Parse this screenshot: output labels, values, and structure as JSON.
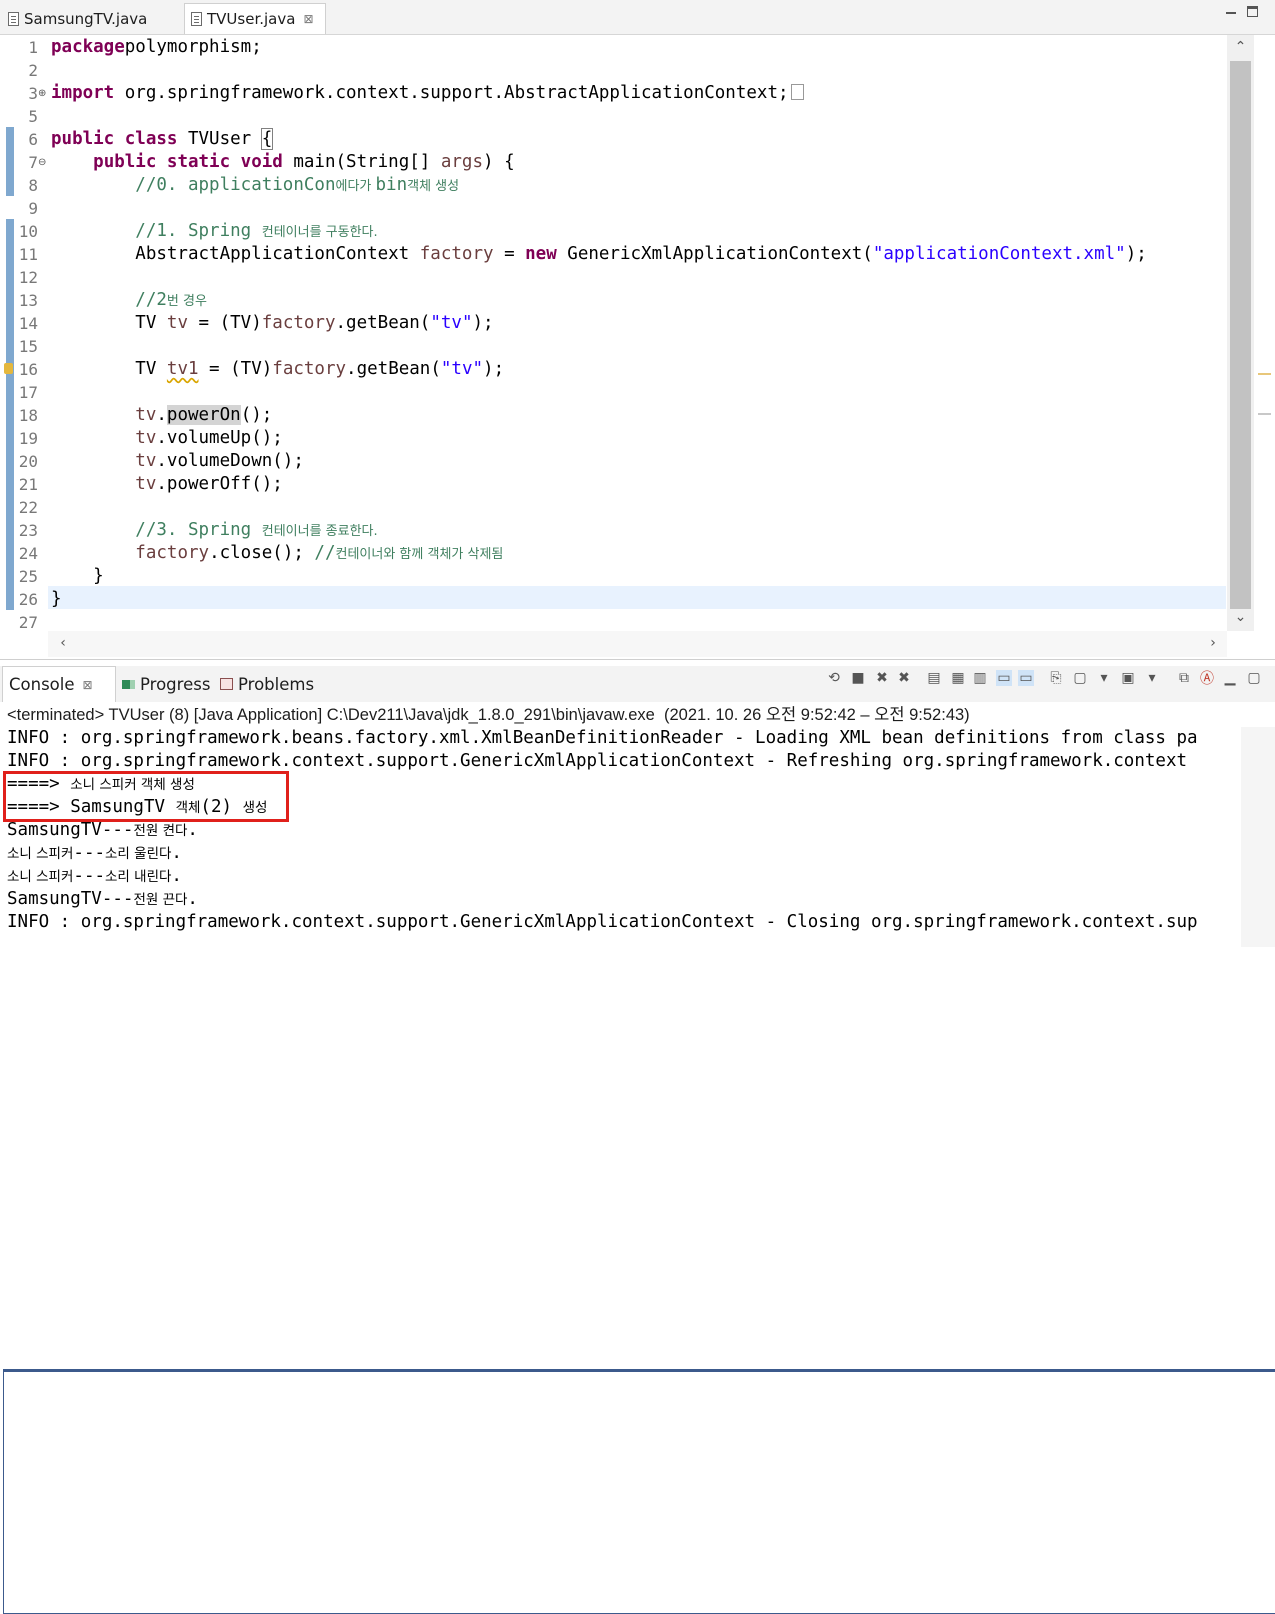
{
  "editor_tabs": [
    {
      "label": "SamsungTV.java",
      "active": false
    },
    {
      "label": "TVUser.java",
      "active": true,
      "close": "⊠"
    }
  ],
  "code_lines": [
    {
      "n": "1",
      "segs": [
        [
          "kw",
          "package"
        ],
        [
          "",
          "polymorphism;"
        ]
      ]
    },
    {
      "n": "2",
      "segs": []
    },
    {
      "n": "3",
      "segs": [
        [
          "kw",
          "import"
        ],
        [
          "",
          " org.springframework.context.support.AbstractApplicationContext;"
        ]
      ]
    },
    {
      "n": "5",
      "segs": []
    },
    {
      "n": "6",
      "segs": [
        [
          "kw",
          "public class"
        ],
        [
          "",
          " TVUser "
        ],
        [
          "brace",
          "{"
        ]
      ]
    },
    {
      "n": "7",
      "segs": [
        [
          "",
          "    "
        ],
        [
          "kw",
          "public static void"
        ],
        [
          "",
          " main(String[] "
        ],
        [
          "var",
          "args"
        ],
        [
          "",
          ") {"
        ]
      ]
    },
    {
      "n": "8",
      "segs": [
        [
          "",
          "        "
        ],
        [
          "cm",
          "//0. applicationCon"
        ],
        [
          "cmko",
          "에다가 "
        ],
        [
          "cm",
          "bin"
        ],
        [
          "cmko",
          "객체 생성"
        ]
      ]
    },
    {
      "n": "9",
      "segs": []
    },
    {
      "n": "10",
      "segs": [
        [
          "",
          "        "
        ],
        [
          "cm",
          "//1. Spring "
        ],
        [
          "cmko",
          "컨테이너를 구동한다."
        ]
      ]
    },
    {
      "n": "11",
      "segs": [
        [
          "",
          "        AbstractApplicationContext "
        ],
        [
          "var",
          "factory"
        ],
        [
          "",
          " = "
        ],
        [
          "kw",
          "new"
        ],
        [
          "",
          " GenericXmlApplicationContext("
        ],
        [
          "str",
          "\"applicationContext.xml\""
        ],
        [
          "",
          ");"
        ]
      ]
    },
    {
      "n": "12",
      "segs": []
    },
    {
      "n": "13",
      "segs": [
        [
          "",
          "        "
        ],
        [
          "cm",
          "//2"
        ],
        [
          "cmko",
          "번 경우"
        ]
      ]
    },
    {
      "n": "14",
      "segs": [
        [
          "",
          "        TV "
        ],
        [
          "var",
          "tv"
        ],
        [
          "",
          " = (TV)"
        ],
        [
          "var",
          "factory"
        ],
        [
          "",
          ".getBean("
        ],
        [
          "str",
          "\"tv\""
        ],
        [
          "",
          ");"
        ]
      ]
    },
    {
      "n": "15",
      "segs": []
    },
    {
      "n": "16",
      "segs": [
        [
          "",
          "        TV "
        ],
        [
          "varwarn",
          "tv1"
        ],
        [
          "",
          " = (TV)"
        ],
        [
          "var",
          "factory"
        ],
        [
          "",
          ".getBean("
        ],
        [
          "str",
          "\"tv\""
        ],
        [
          "",
          ");"
        ]
      ]
    },
    {
      "n": "17",
      "segs": []
    },
    {
      "n": "18",
      "segs": [
        [
          "",
          "        "
        ],
        [
          "var",
          "tv"
        ],
        [
          "",
          "."
        ],
        [
          "hl",
          "powerOn"
        ],
        [
          "",
          "();"
        ]
      ]
    },
    {
      "n": "19",
      "segs": [
        [
          "",
          "        "
        ],
        [
          "var",
          "tv"
        ],
        [
          "",
          ".volumeUp();"
        ]
      ]
    },
    {
      "n": "20",
      "segs": [
        [
          "",
          "        "
        ],
        [
          "var",
          "tv"
        ],
        [
          "",
          ".volumeDown();"
        ]
      ]
    },
    {
      "n": "21",
      "segs": [
        [
          "",
          "        "
        ],
        [
          "var",
          "tv"
        ],
        [
          "",
          ".powerOff();"
        ]
      ]
    },
    {
      "n": "22",
      "segs": []
    },
    {
      "n": "23",
      "segs": [
        [
          "",
          "        "
        ],
        [
          "cm",
          "//3. Spring "
        ],
        [
          "cmko",
          "컨테이너를 종료한다."
        ]
      ]
    },
    {
      "n": "24",
      "segs": [
        [
          "",
          "        "
        ],
        [
          "var",
          "factory"
        ],
        [
          "",
          ".close(); "
        ],
        [
          "cm",
          "//"
        ],
        [
          "cmko",
          "컨테이너와 함께 객체가 삭제됨"
        ]
      ]
    },
    {
      "n": "25",
      "segs": [
        [
          "",
          "    }"
        ]
      ]
    },
    {
      "n": "26",
      "segs": [
        [
          "",
          "}"
        ]
      ]
    },
    {
      "n": "27",
      "segs": []
    }
  ],
  "view_tabs": [
    {
      "label": "Console",
      "icon": "console-icon",
      "active": true,
      "close": "⊠"
    },
    {
      "label": "Progress",
      "icon": "progress-icon",
      "active": false
    },
    {
      "label": "Problems",
      "icon": "problems-icon",
      "active": false
    }
  ],
  "console": {
    "terminated_line": "<terminated> TVUser (8) [Java Application] C:\\Dev211\\Java\\jdk_1.8.0_291\\bin\\javaw.exe  (2021. 10. 26 오전 9:52:42 – 오전 9:52:43)",
    "lines": [
      "INFO : org.springframework.beans.factory.xml.XmlBeanDefinitionReader - Loading XML bean definitions from class pa",
      "INFO : org.springframework.context.support.GenericXmlApplicationContext - Refreshing org.springframework.context",
      "====> 소니 스피커 객체 생성",
      "====> SamsungTV 객체(2) 생성",
      "SamsungTV---전원 켠다.",
      "소니 스피커---소리 울린다.",
      "소니 스피커---소리 내린다.",
      "SamsungTV---전원 끈다.",
      "INFO : org.springframework.context.support.GenericXmlApplicationContext - Closing org.springframework.context.sup"
    ]
  },
  "colors": {
    "keyword": "#7f0055",
    "string": "#2a00ff",
    "comment": "#3f7f5f",
    "variable": "#6a3e3e",
    "highlight_box": "#e0201b"
  }
}
